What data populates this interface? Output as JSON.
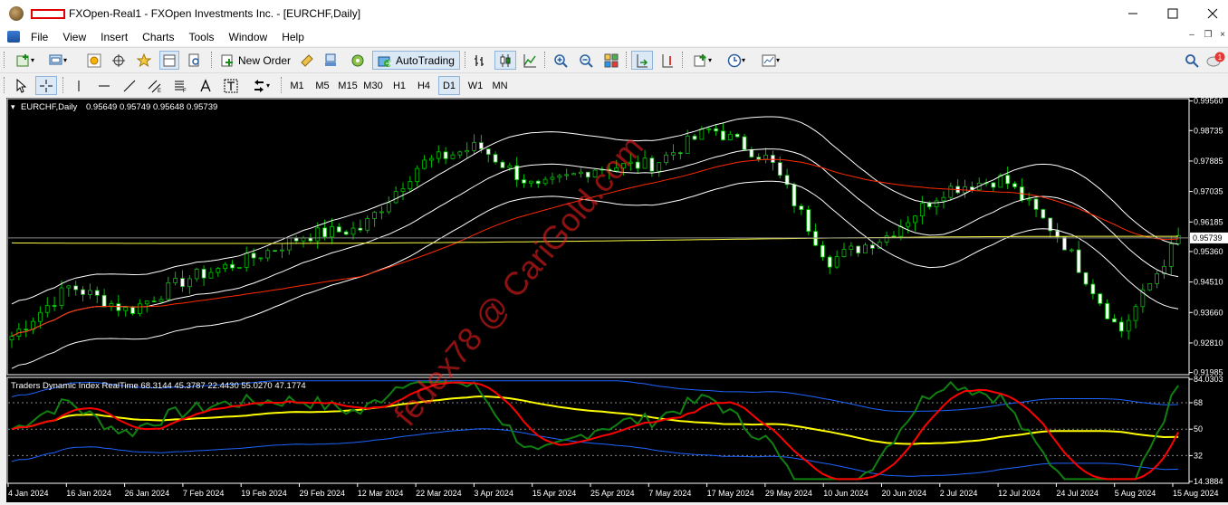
{
  "window": {
    "title": "FXOpen-Real1 - FXOpen Investments Inc. - [EURCHF,Daily]"
  },
  "menu": [
    "File",
    "View",
    "Insert",
    "Charts",
    "Tools",
    "Window",
    "Help"
  ],
  "toolbar": {
    "new_order": "New Order",
    "autotrading": "AutoTrading"
  },
  "timeframes": [
    "M1",
    "M5",
    "M15",
    "M30",
    "H1",
    "H4",
    "D1",
    "W1",
    "MN"
  ],
  "active_timeframe": "D1",
  "notification_count": "1",
  "chart": {
    "symbol_label": "EURCHF,Daily",
    "ohlc": "0.95649 0.95749 0.95648 0.95739",
    "current_price": "0.95739",
    "price_ticks": [
      "0.99560",
      "0.98735",
      "0.97885",
      "0.97035",
      "0.96185",
      "0.95360",
      "0.94510",
      "0.93660",
      "0.92810",
      "0.91985"
    ],
    "indicator_label": "Traders Dynamic Index RealTime 68.3144 45.3787 22.4430 55.0270 47.1774",
    "indicator_ticks": [
      "84.0303",
      "68",
      "50",
      "32",
      "14.3884"
    ],
    "date_ticks": [
      "4 Jan 2024",
      "16 Jan 2024",
      "26 Jan 2024",
      "7 Feb 2024",
      "19 Feb 2024",
      "29 Feb 2024",
      "12 Mar 2024",
      "22 Mar 2024",
      "3 Apr 2024",
      "15 Apr 2024",
      "25 Apr 2024",
      "7 May 2024",
      "17 May 2024",
      "29 May 2024",
      "10 Jun 2024",
      "20 Jun 2024",
      "2 Jul 2024",
      "12 Jul 2024",
      "24 Jul 2024",
      "5 Aug 2024",
      "15 Aug 2024"
    ],
    "watermark": "fedex78 @ CariGold.com",
    "colors": {
      "bull": "#ffffff",
      "bear": "#ffffff",
      "wick": "#00c000",
      "ma_red": "#ff2a00",
      "ma_yellow": "#ffff40",
      "bands": "#ffffff",
      "tdi_green": "#108010",
      "tdi_red": "#ff0000",
      "tdi_yellow": "#ffff00",
      "tdi_blue": "#1e64ff"
    }
  },
  "chart_data": {
    "type": "candlestick",
    "symbol": "EURCHF",
    "timeframe": "Daily",
    "x": [
      "4 Jan 2024",
      "16 Jan 2024",
      "26 Jan 2024",
      "7 Feb 2024",
      "19 Feb 2024",
      "29 Feb 2024",
      "12 Mar 2024",
      "22 Mar 2024",
      "3 Apr 2024",
      "15 Apr 2024",
      "25 Apr 2024",
      "7 May 2024",
      "17 May 2024",
      "29 May 2024",
      "10 Jun 2024",
      "20 Jun 2024",
      "2 Jul 2024",
      "12 Jul 2024",
      "24 Jul 2024",
      "5 Aug 2024",
      "15 Aug 2024"
    ],
    "close": [
      0.93,
      0.944,
      0.937,
      0.946,
      0.951,
      0.958,
      0.96,
      0.978,
      0.983,
      0.971,
      0.977,
      0.978,
      0.988,
      0.979,
      0.951,
      0.958,
      0.971,
      0.974,
      0.957,
      0.931,
      0.9574
    ],
    "last": {
      "open": 0.95649,
      "high": 0.95749,
      "low": 0.95648,
      "close": 0.95739
    },
    "ylim": [
      0.9195,
      0.996
    ],
    "indicator": {
      "name": "Traders Dynamic Index RealTime",
      "values": [
        68.3144,
        45.3787,
        22.443,
        55.027,
        47.1774
      ],
      "levels": [
        68,
        50,
        32
      ],
      "ylim": [
        14.3884,
        84.0303
      ]
    }
  }
}
